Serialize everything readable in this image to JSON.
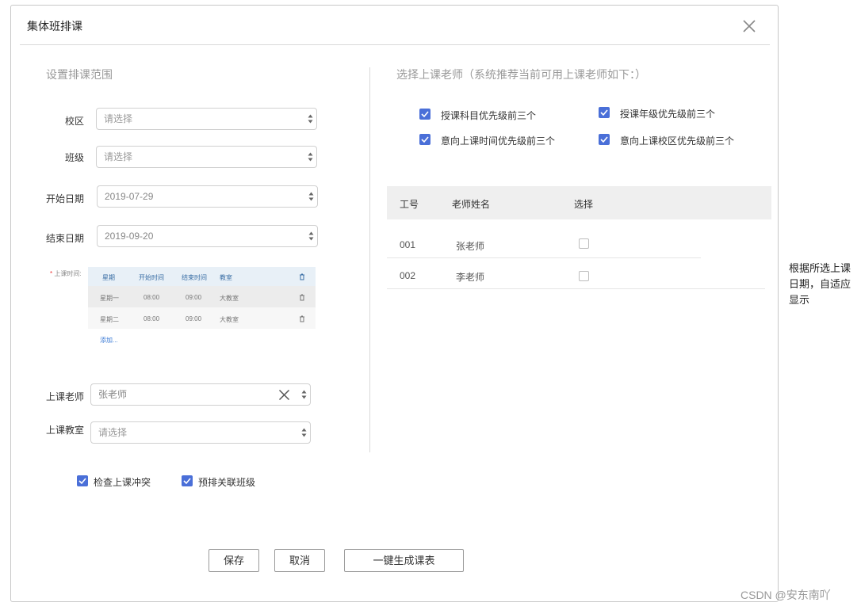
{
  "dialog": {
    "title": "集体班排课",
    "close_icon": "close-icon"
  },
  "left": {
    "section_title": "设置排课范围",
    "campus": {
      "label": "校区",
      "placeholder": "请选择"
    },
    "class": {
      "label": "班级",
      "placeholder": "请选择"
    },
    "start_date": {
      "label": "开始日期",
      "value": "2019-07-29"
    },
    "end_date": {
      "label": "结束日期",
      "value": "2019-09-20"
    },
    "schedule": {
      "label": "上课时间:",
      "required_mark": "*",
      "headers": [
        "星期",
        "开始时间",
        "结束时间",
        "教室"
      ],
      "rows": [
        {
          "day": "星期一",
          "start": "08:00",
          "end": "09:00",
          "room": "大教室"
        },
        {
          "day": "星期二",
          "start": "08:00",
          "end": "09:00",
          "room": "大教室"
        }
      ],
      "add_label": "添加..."
    },
    "teacher": {
      "label": "上课老师",
      "value": "张老师"
    },
    "classroom": {
      "label": "上课教室",
      "placeholder": "请选择"
    },
    "options": [
      {
        "label": "检查上课冲突",
        "checked": true
      },
      {
        "label": "预排关联班级",
        "checked": true
      }
    ]
  },
  "right": {
    "section_title": "选择上课老师（系统推荐当前可用上课老师如下：）",
    "filters": [
      {
        "label": "授课科目优先级前三个",
        "checked": true
      },
      {
        "label": "授课年级优先级前三个",
        "checked": true
      },
      {
        "label": "意向上课时间优先级前三个",
        "checked": true
      },
      {
        "label": "意向上课校区优先级前三个",
        "checked": true
      }
    ],
    "table": {
      "headers": [
        "工号",
        "老师姓名",
        "选择"
      ],
      "rows": [
        {
          "id": "001",
          "name": "张老师",
          "selected": false
        },
        {
          "id": "002",
          "name": "李老师",
          "selected": false
        }
      ]
    }
  },
  "footer": {
    "save": "保存",
    "cancel": "取消",
    "generate": "一键生成课表"
  },
  "side_note": "根据所选上课日期，自适应显示",
  "watermark": "CSDN @安东南吖",
  "colors": {
    "checkbox": "#4a6fd8",
    "border": "#d0d0d0",
    "link": "#3a7ad5"
  }
}
